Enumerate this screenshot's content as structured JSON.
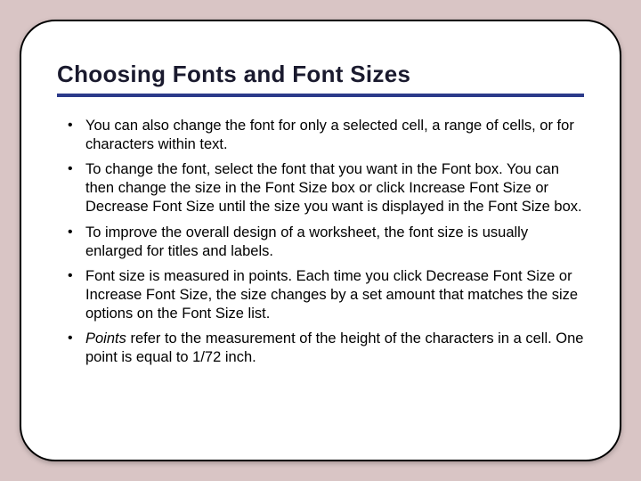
{
  "title": "Choosing Fonts and Font Sizes",
  "bullets": [
    {
      "text": "You can also change the font for only a selected cell, a range of cells, or for characters within text."
    },
    {
      "text": "To change the font, select the font that you want in the Font box. You can then change the size in the Font Size box or click Increase Font Size or Decrease Font Size until the size you want is displayed in the Font Size box."
    },
    {
      "text": "To improve the overall design of a worksheet, the font size is usually enlarged for titles and labels."
    },
    {
      "text": "Font size is measured in points. Each time you click Decrease Font Size or Increase Font Size, the size changes by a set amount that matches the size options on the Font Size list."
    },
    {
      "lead": "Points",
      "text": " refer to the measurement of the height of the characters in a cell. One point is equal to 1/72 inch."
    }
  ]
}
